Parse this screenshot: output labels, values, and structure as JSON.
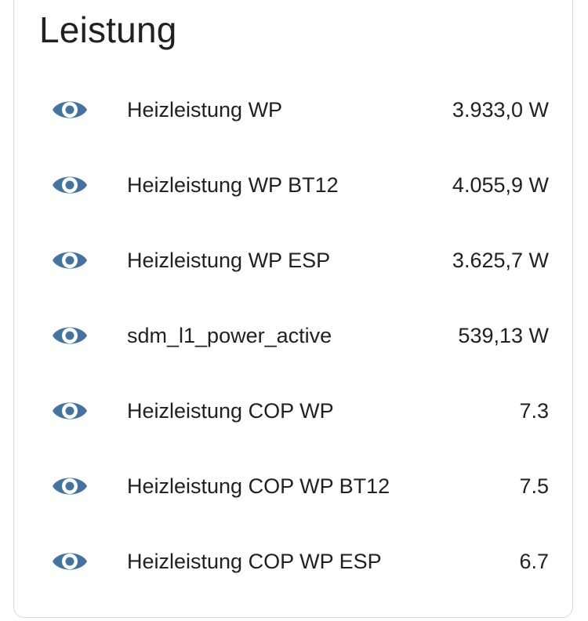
{
  "card": {
    "title": "Leistung"
  },
  "colors": {
    "icon": "#44739e",
    "text": "#212121",
    "border": "#d9d9d9"
  },
  "entities": [
    {
      "icon": "eye-icon",
      "name": "Heizleistung WP",
      "state": "3.933,0 W"
    },
    {
      "icon": "eye-icon",
      "name": "Heizleistung WP BT12",
      "state": "4.055,9 W"
    },
    {
      "icon": "eye-icon",
      "name": "Heizleistung WP ESP",
      "state": "3.625,7 W"
    },
    {
      "icon": "eye-icon",
      "name": "sdm_l1_power_active",
      "state": "539,13 W"
    },
    {
      "icon": "eye-icon",
      "name": "Heizleistung COP WP",
      "state": "7.3"
    },
    {
      "icon": "eye-icon",
      "name": "Heizleistung COP WP BT12",
      "state": "7.5"
    },
    {
      "icon": "eye-icon",
      "name": "Heizleistung COP WP ESP",
      "state": "6.7"
    }
  ]
}
